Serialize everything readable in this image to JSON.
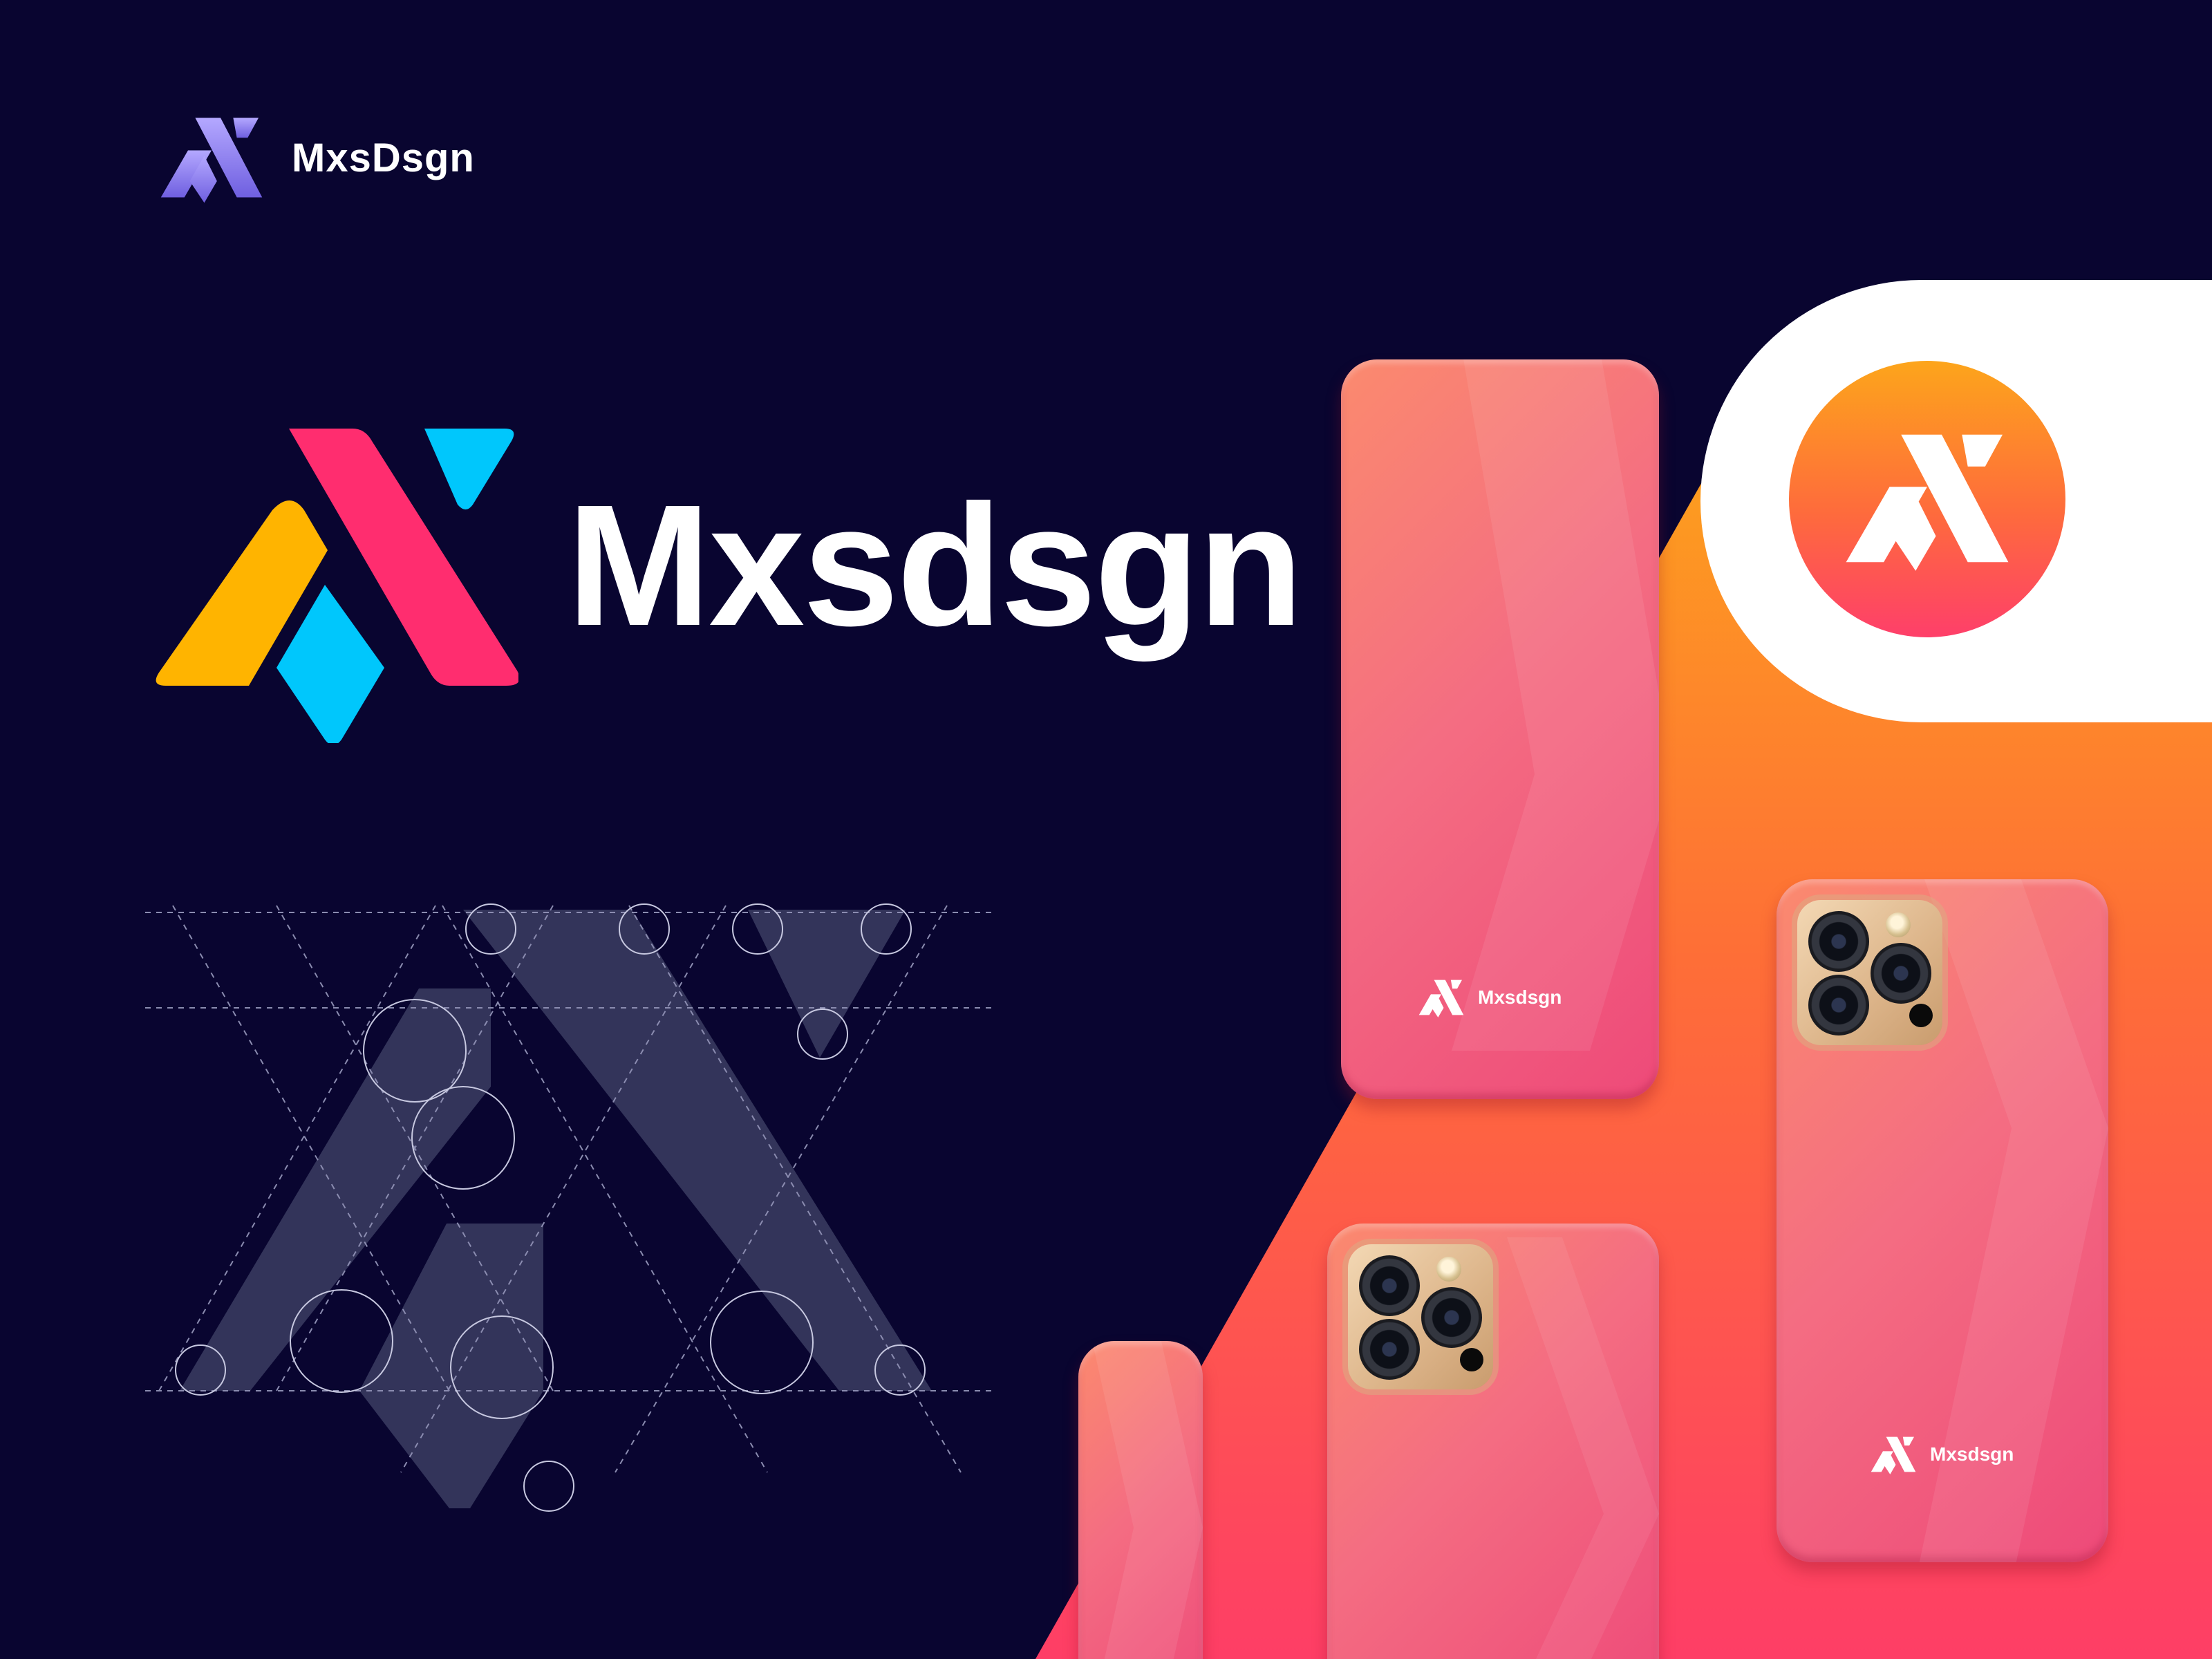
{
  "brand": {
    "small_label": "MxsDsgn",
    "main_label": "Mxsdsgn",
    "phone_label": "Mxsdsgn"
  },
  "colors": {
    "background": "#090530",
    "logo_yellow": "#ffb400",
    "logo_pink": "#ff2d6f",
    "logo_cyan": "#00c7fc",
    "small_logo_purple": "#8f7ff4",
    "gradient_orange": "#fda51b",
    "gradient_pink": "#fe3e66",
    "grid_fill": "#33345a"
  },
  "icons": {
    "small_logo": "mx-logo-monochrome-icon",
    "main_logo": "mx-logo-color-icon",
    "app_icon": "mx-app-icon",
    "phone_logo": "mx-logo-white-icon"
  }
}
